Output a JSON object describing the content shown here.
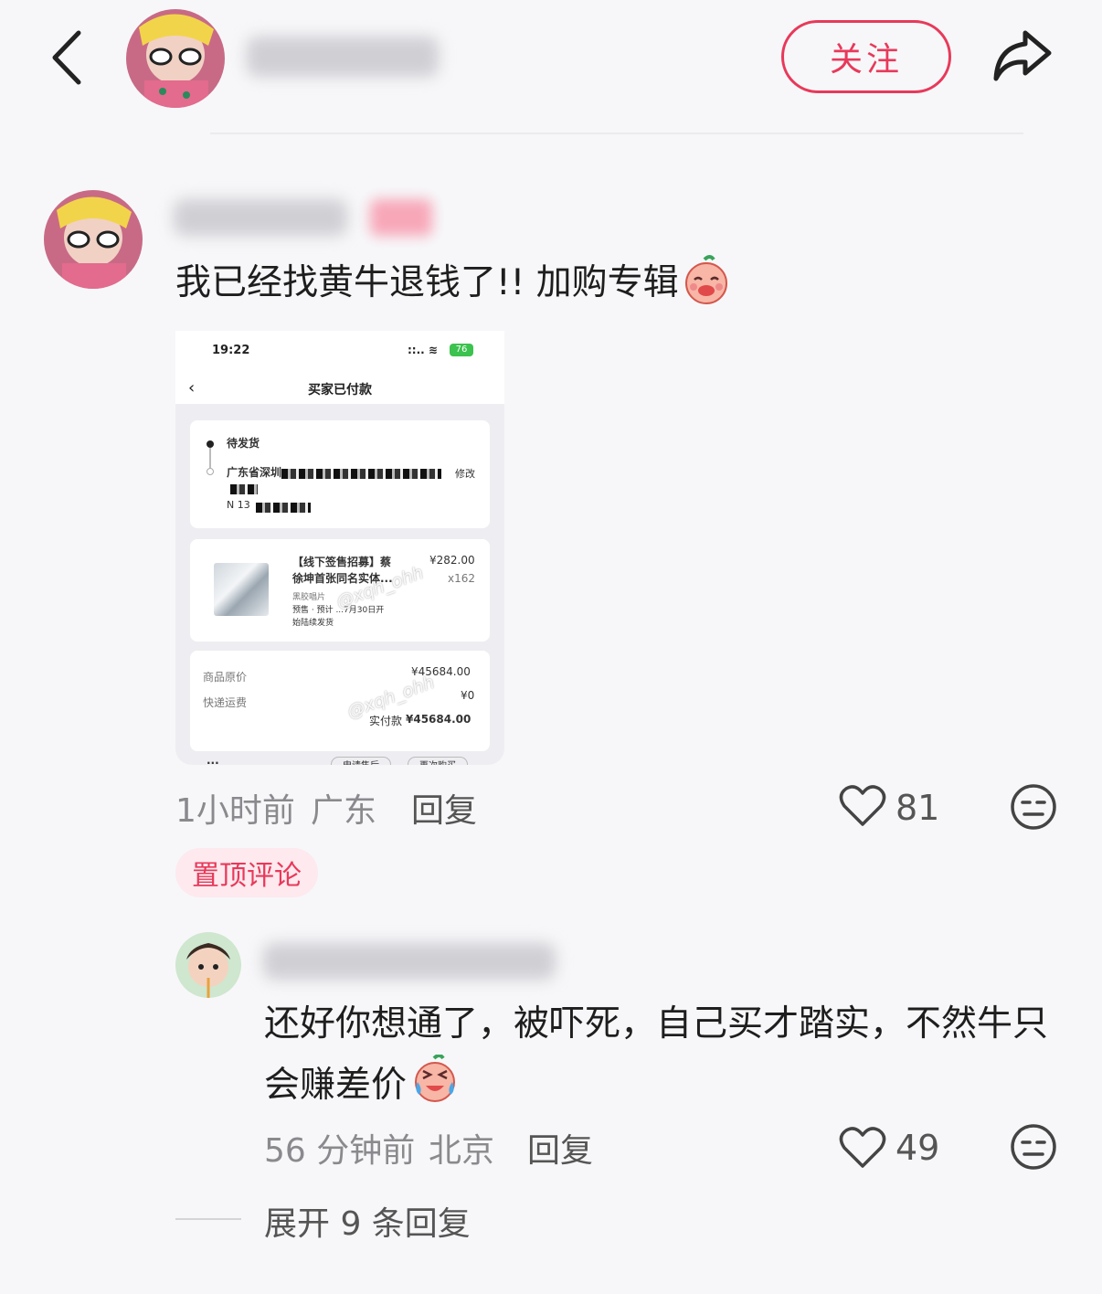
{
  "header": {
    "follow_label": "关注"
  },
  "comment": {
    "text": "我已经找黄牛退钱了!! 加购专辑",
    "time": "1小时前",
    "location": "广东",
    "reply_label": "回复",
    "likes": "81",
    "pinned_label": "置顶评论"
  },
  "screenshot": {
    "time": "19:22",
    "battery": "76",
    "title": "买家已付款",
    "status": "待发货",
    "address": "广东省深圳",
    "modify": "修改",
    "address_line": "N 13",
    "product_title_1": "【线下签售招募】蔡",
    "product_title_2": "徐坤首张同名实体...",
    "product_price": "¥282.00",
    "product_qty": "x162",
    "product_type": "黑胶唱片",
    "product_note_1": "预售 · 预计 ...7月30日开",
    "product_note_2": "始陆续发货",
    "original_price_label": "商品原价",
    "original_price": "¥45684.00",
    "shipping_label": "快递运费",
    "shipping": "¥0",
    "paid_label": "实付款",
    "paid": "¥45684.00",
    "btn_after_sale": "申请售后",
    "btn_buy_again": "再次购买",
    "more": "···",
    "watermark": "@xqh_ohh"
  },
  "reply": {
    "text": "还好你想通了，被吓死，自己买才踏实，不然牛只会赚差价",
    "time": "56 分钟前",
    "location": "北京",
    "reply_label": "回复",
    "likes": "49"
  },
  "expand_label": "展开 9 条回复",
  "colors": {
    "accent": "#e8395a",
    "pinned_bg": "#fde9ee",
    "background": "#f7f7f9"
  },
  "icons": [
    "back-icon",
    "share-icon",
    "heart-icon",
    "dislike-icon",
    "peach-emoji",
    "laugh-cry-emoji"
  ]
}
